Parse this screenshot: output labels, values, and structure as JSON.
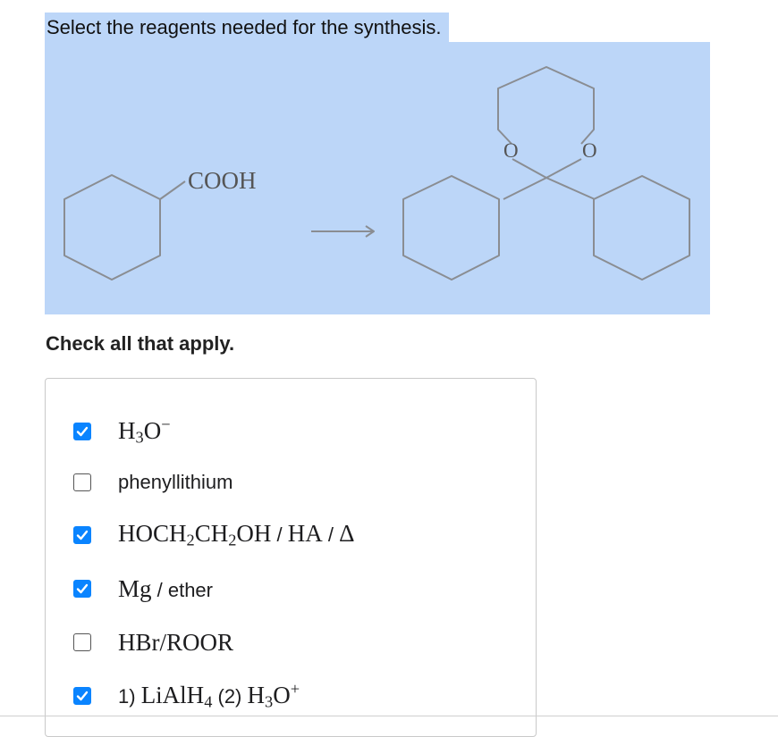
{
  "question": "Select the reagents needed for the synthesis.",
  "scheme": {
    "substituent_label": "COOH",
    "oxygen_left": "O",
    "oxygen_right": "O"
  },
  "instruction": "Check all that apply.",
  "options": [
    {
      "checked": true,
      "parts": {
        "a": "H",
        "b": "3",
        "c": "O",
        "d": "−"
      }
    },
    {
      "checked": false,
      "text": "phenyllithium"
    },
    {
      "checked": true,
      "parts": {
        "a": "HOCH",
        "b": "2",
        "c": "CH",
        "d": "2",
        "e": "OH",
        "f": " / ",
        "g": "HA",
        "h": " / ",
        "i": "Δ"
      }
    },
    {
      "checked": true,
      "parts": {
        "a": "Mg",
        "b": " / ether"
      }
    },
    {
      "checked": false,
      "parts": {
        "a": "HBr/ROOR"
      }
    },
    {
      "checked": true,
      "parts": {
        "a": "1) ",
        "b": "LiAlH",
        "c": "4",
        "d": " (2) ",
        "e": "H",
        "f": "3",
        "g": "O",
        "h": "+"
      }
    }
  ],
  "colors": {
    "selection": "#bcd6f8",
    "checkbox_checked": "#0a84ff"
  }
}
